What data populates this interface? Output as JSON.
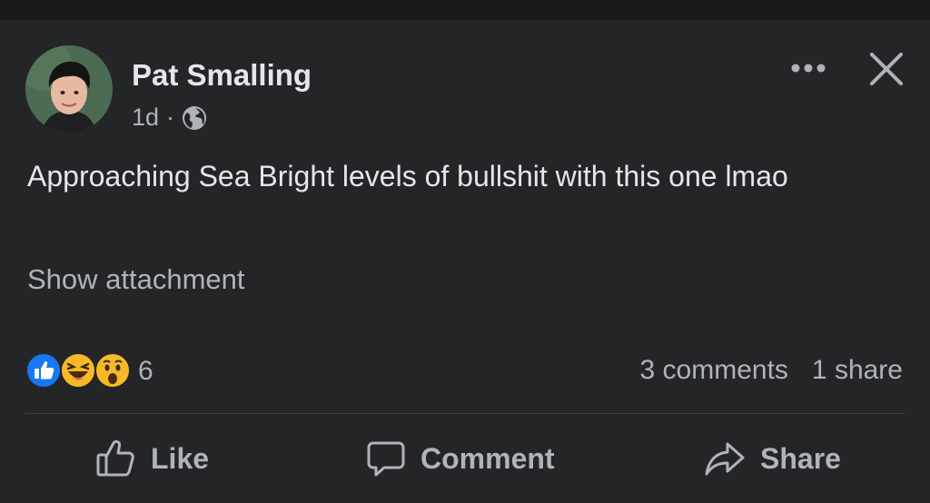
{
  "post": {
    "author": "Pat Smalling",
    "time": "1d",
    "separator": "·",
    "text": "Approaching Sea Bright levels of bullshit with this one lmao",
    "show_attachment": "Show attachment"
  },
  "reactions": {
    "icons": [
      "like-icon",
      "haha-icon",
      "wow-icon"
    ],
    "count": "6"
  },
  "stats": {
    "comments": "3 comments",
    "shares": "1 share"
  },
  "actions": {
    "like": "Like",
    "comment": "Comment",
    "share": "Share"
  },
  "colors": {
    "background": "#242526",
    "text_primary": "#e4e6eb",
    "text_secondary": "#b0b3b8",
    "like_blue": "#1877f2",
    "emoji_yellow": "#f7b928"
  }
}
